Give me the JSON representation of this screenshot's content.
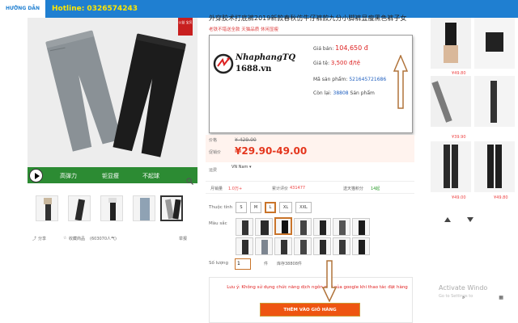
{
  "topbar": {
    "guide": "HƯỚNG DẪN",
    "hotline": "Hotline: 0326574243"
  },
  "gallery": {
    "badge": "公益 宝贝",
    "features": [
      "高弹力",
      "钜显瘦",
      "不起球"
    ],
    "icons": {
      "play": "play-icon",
      "zoom": "zoom-icon"
    }
  },
  "share_row": {
    "share": "分享",
    "favorite": "收藏商品",
    "popularity": "(603070人气)",
    "report": "举报"
  },
  "product": {
    "title": "外穿胶术打底裤2019新款春秋仿牛仔裤款九分小脚裤显瘦黑色裤子女",
    "subtitle": "老铁不错送全款 天猫品质 休闲显瘦"
  },
  "info_box": {
    "logo_line1": "NhaphangTQ",
    "logo_line2": "1688.vn",
    "price_label": "Giá bán:",
    "price_value": "104,650 đ",
    "rate_label": "Giá tệ:",
    "rate_value": "3,500 đ/tệ",
    "sku_label": "Mã sản phẩm:",
    "sku_value": "521645721686",
    "stock_label": "Còn lại:",
    "stock_value": "38808",
    "stock_unit": "Sản phẩm"
  },
  "pricing": {
    "old_label": "价格",
    "old_price": "¥ 429.00",
    "new_label": "促销价",
    "new_price": "¥29.90-49.00"
  },
  "shipping": {
    "label": "运费",
    "value": "VN Nam ▾"
  },
  "stats": {
    "sales_label": "月销量",
    "sales_value": "1.0万+",
    "reviews_label": "累计评价",
    "reviews_value": "431477",
    "points_label": "送天猫积分",
    "points_value": "14起"
  },
  "size": {
    "label": "Thuộc tính",
    "options": [
      "S",
      "M",
      "L",
      "XL",
      "XXL"
    ],
    "selected": "L"
  },
  "color": {
    "label": "Màu sắc"
  },
  "quantity": {
    "label": "Số lượng",
    "value": "1",
    "unit": "件",
    "stock": "库存38808件"
  },
  "note": {
    "text": "Lưu ý: Không sử dụng chức năng dịch ngôn ngữ của google khi thao tác đặt hàng",
    "add_to_cart": "THÊM VÀO GIỎ HÀNG"
  },
  "sidebar": {
    "prices": [
      "¥49.80",
      "¥39.90",
      "¥49.00",
      "¥49.80"
    ]
  },
  "watermark": {
    "line1": "Activate Windo",
    "line2": "Go to Settings to"
  },
  "colors": {
    "topbar": "#1f7fd1",
    "hotline": "#ffe600",
    "price_red": "#e4361d",
    "accent_orange": "#ee5511",
    "arrow_brown": "#b0733a"
  }
}
